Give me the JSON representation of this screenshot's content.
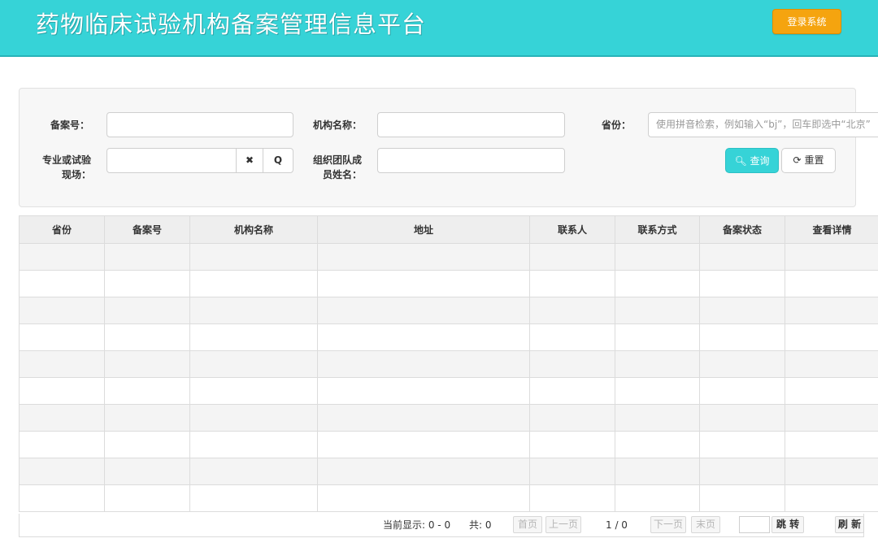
{
  "header": {
    "title": "药物临床试验机构备案管理信息平台",
    "login_label": "登录系统"
  },
  "search": {
    "record_no_label": "备案号：",
    "institution_name_label": "机构名称：",
    "province_label": "省份：",
    "province_placeholder": "使用拼音检索，例如输入“bj”，回车即选中“北京”",
    "specialty_label_line1": "专业或试验",
    "specialty_label_line2": "现场：",
    "team_member_label_line1": "组织团队成",
    "team_member_label_line2": "员姓名：",
    "clear_glyph": "✖",
    "search_glyph": "Q",
    "query_label": "查询",
    "reset_label": "重置"
  },
  "table": {
    "columns": [
      "省份",
      "备案号",
      "机构名称",
      "地址",
      "联系人",
      "联系方式",
      "备案状态",
      "查看详情"
    ],
    "rows": [
      [],
      [],
      [],
      [],
      [],
      [],
      [],
      [],
      [],
      []
    ]
  },
  "pager": {
    "current_display": "当前显示: 0 - 0",
    "total": "共: 0",
    "first": "首页",
    "prev": "上一页",
    "page_info": "1 / 0",
    "next": "下一页",
    "last": "末页",
    "jump": "跳 转",
    "refresh": "刷 新"
  },
  "colors": {
    "header_bg": "#36d3d7",
    "login_bg": "#f5a40f",
    "query_bg": "#36d3d7"
  }
}
